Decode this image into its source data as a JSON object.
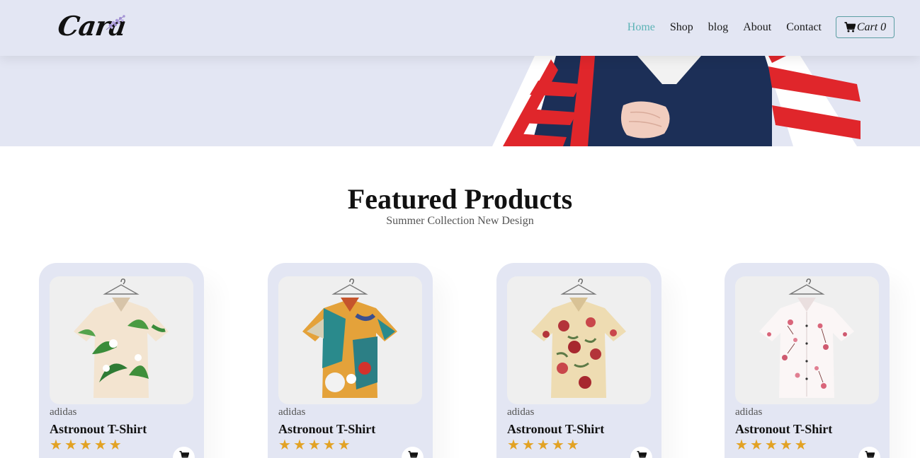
{
  "brand": {
    "logo_text": "Cara"
  },
  "nav": {
    "links": [
      {
        "label": "Home",
        "active": true
      },
      {
        "label": "Shop",
        "active": false
      },
      {
        "label": "blog",
        "active": false
      },
      {
        "label": "About",
        "active": false
      },
      {
        "label": "Contact",
        "active": false
      }
    ],
    "cart_label": "Cart",
    "cart_count": "0"
  },
  "featured": {
    "title": "Featured Products",
    "subtitle": "Summer Collection New Design"
  },
  "products": [
    {
      "brand": "adidas",
      "name": "Astronout T-Shirt",
      "rating": 5,
      "icon": "palm-leaf-shirt"
    },
    {
      "brand": "adidas",
      "name": "Astronout T-Shirt",
      "rating": 5,
      "icon": "abstract-color-shirt"
    },
    {
      "brand": "adidas",
      "name": "Astronout T-Shirt",
      "rating": 5,
      "icon": "rose-floral-shirt"
    },
    {
      "brand": "adidas",
      "name": "Astronout T-Shirt",
      "rating": 5,
      "icon": "pink-blossom-shirt"
    }
  ],
  "colors": {
    "header_bg": "#e3e6f3",
    "accent": "#5cb3b6",
    "star": "#e2a224"
  }
}
